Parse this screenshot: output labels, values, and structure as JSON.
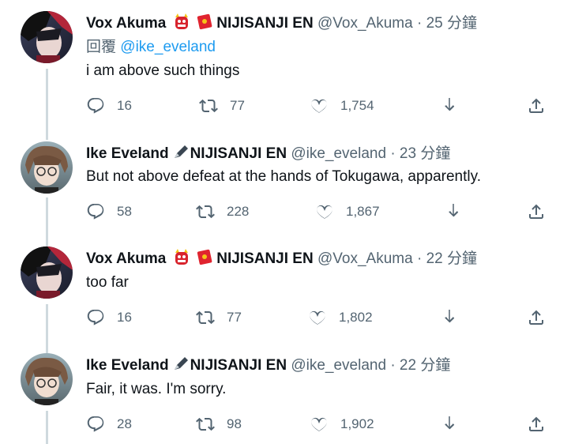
{
  "tweets": [
    {
      "name": "Vox Akuma",
      "org": "NIJISANJI EN",
      "handle": "@Vox_Akuma",
      "time": "25 分鐘",
      "reply_prefix": "回覆",
      "reply_mention": "@ike_eveland",
      "text": "i am above such things",
      "replies": "16",
      "retweets": "77",
      "likes": "1,754"
    },
    {
      "name": "Ike Eveland",
      "org": "NIJISANJI EN",
      "handle": "@ike_eveland",
      "time": "23 分鐘",
      "text": "But not above defeat at the hands of Tokugawa, apparently.",
      "replies": "58",
      "retweets": "228",
      "likes": "1,867"
    },
    {
      "name": "Vox Akuma",
      "org": "NIJISANJI EN",
      "handle": "@Vox_Akuma",
      "time": "22 分鐘",
      "text": "too far",
      "replies": "16",
      "retweets": "77",
      "likes": "1,802"
    },
    {
      "name": "Ike Eveland",
      "org": "NIJISANJI EN",
      "handle": "@ike_eveland",
      "time": "22 分鐘",
      "text": "Fair, it was. I'm sorry.",
      "replies": "28",
      "retweets": "98",
      "likes": "1,902"
    }
  ],
  "separator": "·",
  "icons": {
    "reply": "speech-bubble-icon",
    "retweet": "retweet-icon",
    "like": "heart-icon",
    "download": "download-arrow-icon",
    "share": "share-icon"
  },
  "colors": {
    "text": "#0f1419",
    "secondary": "#536471",
    "link": "#1d9bf0",
    "thread_line": "#cfd9de"
  }
}
